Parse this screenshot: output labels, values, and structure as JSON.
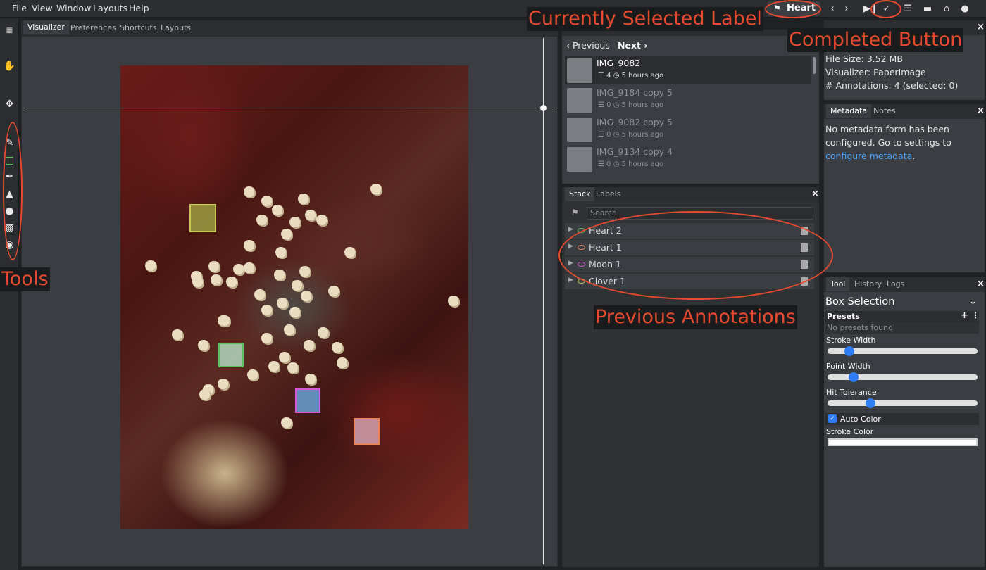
{
  "menubar": {
    "items": [
      "File",
      "View",
      "Window",
      "Layouts",
      "Help"
    ],
    "selected_label": "Heart"
  },
  "visualizer": {
    "tabs": [
      "Visualizer",
      "Preferences",
      "Shortcuts",
      "Layouts"
    ]
  },
  "dataset": {
    "previous": "Previous",
    "next": "Next",
    "files": [
      {
        "name": "IMG_9082",
        "count": "4",
        "time": "5 hours ago"
      },
      {
        "name": "IMG_9184 copy 5",
        "count": "0",
        "time": "5 hours ago"
      },
      {
        "name": "IMG_9082 copy 5",
        "count": "0",
        "time": "5 hours ago"
      },
      {
        "name": "IMG_9134 copy 4",
        "count": "0",
        "time": "5 hours ago"
      }
    ]
  },
  "stack": {
    "tabs": [
      "Stack",
      "Labels"
    ],
    "search_placeholder": "Search",
    "rows": [
      {
        "label": "Heart 2",
        "color": "#5cbf5c"
      },
      {
        "label": "Heart 1",
        "color": "#e8835a"
      },
      {
        "label": "Moon 1",
        "color": "#d65ad6"
      },
      {
        "label": "Clover 1",
        "color": "#c8c85a"
      }
    ]
  },
  "info": {
    "file_size": "File Size: 3.52 MB",
    "visualizer": "Visualizer: PaperImage",
    "annotations": "# Annotations: 4 (selected: 0)"
  },
  "metadata": {
    "tabs": [
      "Metadata",
      "Notes"
    ],
    "text": "No metadata form has been configured. Go to settings to",
    "link": "configure metadata"
  },
  "tool": {
    "tabs": [
      "Tool",
      "History",
      "Logs"
    ],
    "title": "Box Selection",
    "presets": "Presets",
    "no_presets": "No presets found",
    "stroke_width": "Stroke Width",
    "point_width": "Point Width",
    "hit_tolerance": "Hit Tolerance",
    "auto_color": "Auto Color",
    "stroke_color": "Stroke Color",
    "stroke_width_level": 0.12,
    "point_width_level": 0.15,
    "hit_tolerance_level": 0.27
  },
  "callouts": {
    "selected_label": "Currently Selected Label",
    "completed": "Completed Button",
    "tools": "Tools",
    "previous_annotations": "Previous Annotations"
  },
  "colors": {
    "accent": "#e84a2e",
    "link": "#4aa3ff",
    "knob": "#2f7df5"
  }
}
